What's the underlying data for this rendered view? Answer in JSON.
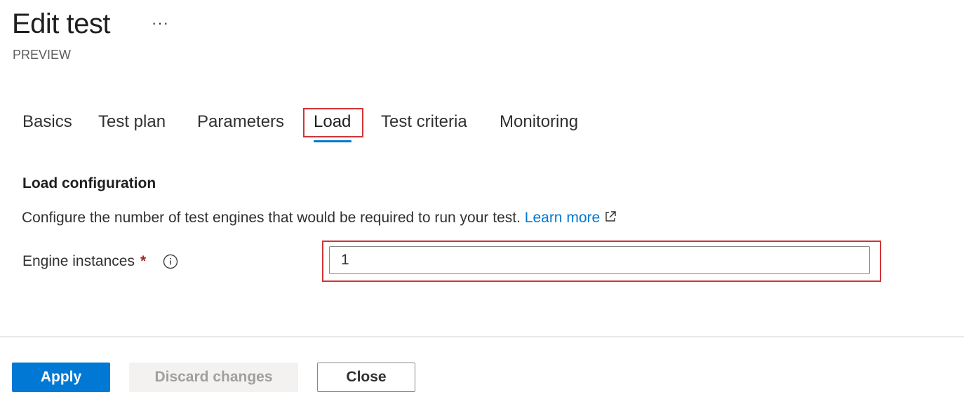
{
  "header": {
    "title": "Edit test",
    "more_label": "···",
    "subtitle": "PREVIEW"
  },
  "tabs": [
    {
      "label": "Basics",
      "selected": false
    },
    {
      "label": "Test plan",
      "selected": false
    },
    {
      "label": "Parameters",
      "selected": false
    },
    {
      "label": "Load",
      "selected": true
    },
    {
      "label": "Test criteria",
      "selected": false
    },
    {
      "label": "Monitoring",
      "selected": false
    }
  ],
  "section": {
    "title": "Load configuration",
    "description": "Configure the number of test engines that would be required to run your test.",
    "learn_more": "Learn more",
    "learn_more_icon": "external-link-icon"
  },
  "fields": {
    "engine_instances": {
      "label": "Engine instances",
      "required_marker": "*",
      "info_icon": "info-icon",
      "value": "1"
    }
  },
  "footer": {
    "apply_label": "Apply",
    "discard_label": "Discard changes",
    "discard_disabled": true,
    "close_label": "Close"
  },
  "colors": {
    "accent": "#0078d4",
    "highlight": "#d13438",
    "required": "#a4262c",
    "text": "#323130",
    "disabled_text": "#a19f9d"
  }
}
